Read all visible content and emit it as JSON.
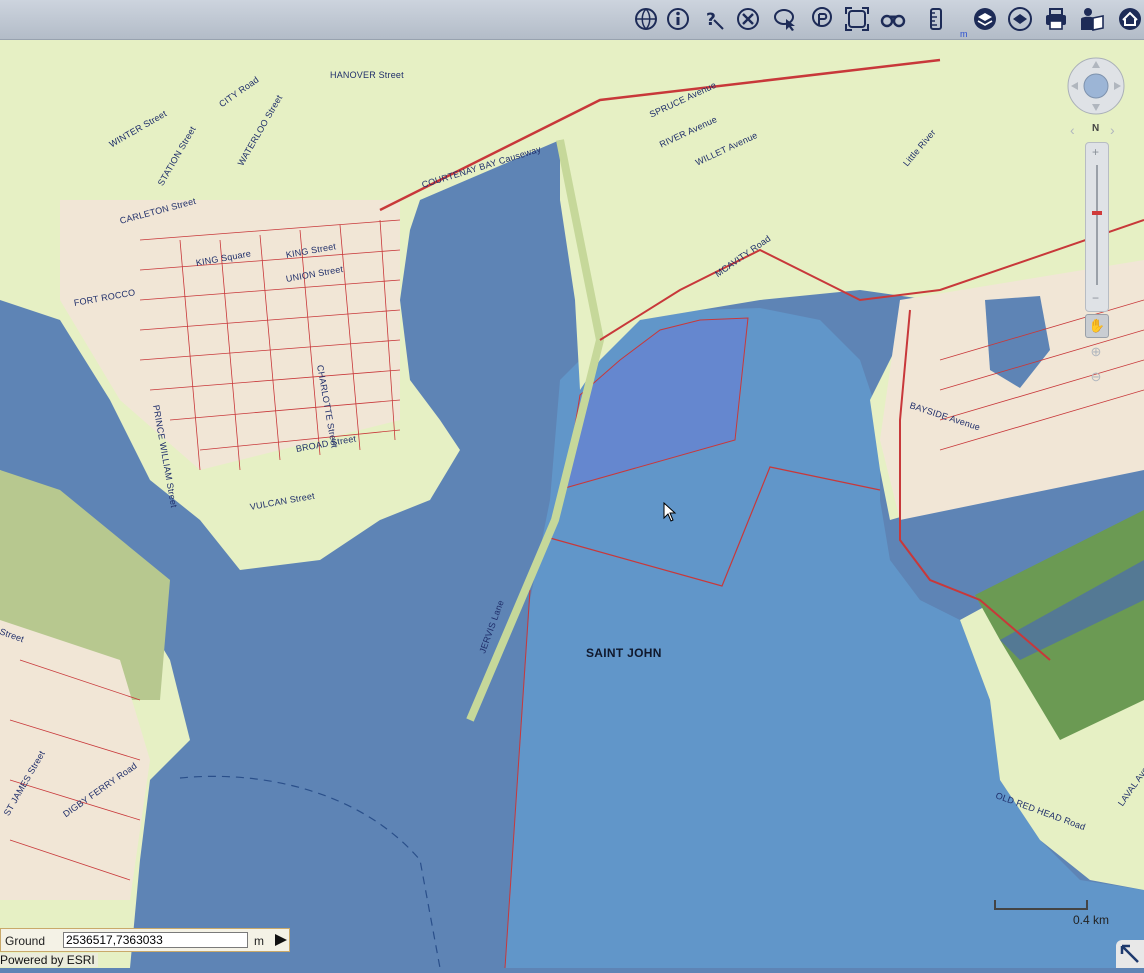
{
  "toolbar": {
    "tools": [
      {
        "name": "globe-icon"
      },
      {
        "name": "info-icon"
      },
      {
        "name": "query-icon"
      },
      {
        "name": "clear-icon"
      },
      {
        "name": "select-icon"
      },
      {
        "name": "identify-icon"
      },
      {
        "name": "extent-icon"
      },
      {
        "name": "binoculars-icon"
      },
      {
        "name": "measure-icon"
      },
      {
        "name": "layers-icon"
      },
      {
        "name": "basemap-icon"
      },
      {
        "name": "print-icon"
      },
      {
        "name": "help-icon"
      },
      {
        "name": "home-icon"
      }
    ],
    "unit_mark": "m"
  },
  "map": {
    "place_label": "SAINT JOHN",
    "street_labels": [
      "HANOVER Street",
      "WINTER Street",
      "CITY Road",
      "STATION Street",
      "WATERLOO Street",
      "COURTENAY BAY Causeway",
      "SPRUCE Avenue",
      "RIVER Avenue",
      "WILLET Avenue",
      "MCAVITY Road",
      "Little River",
      "CARLETON Street",
      "KING Square",
      "KING Street",
      "UNION Street",
      "FORT ROCCO",
      "CHARLOTTE Street",
      "PRINCE WILLIAM Street",
      "BROAD Street",
      "VULCAN Street",
      "JERVIS Lane",
      "DIGBY FERRY Road",
      "ST JAMES Street",
      "OLD RED HEAD Road",
      "BAYSIDE Avenue",
      "Street",
      "LAVAL Avenue"
    ],
    "colors": {
      "harbour_water": "#5e84b5",
      "bay_water": "#6196c9",
      "land": "#e6f0c4",
      "urban": "#f1e6d6",
      "parcel_lines": "#c8383a",
      "park": "#a8bc86"
    }
  },
  "navigation": {
    "north_label": "N",
    "zoom_in": "+",
    "zoom_out": "−",
    "zoom_level": 0.62
  },
  "scalebar": {
    "label": "0.4 km"
  },
  "coordinates": {
    "mode": "Ground",
    "value": "2536517,7363033",
    "unit": "m"
  },
  "footer": {
    "powered_by": "Powered by ESRI"
  }
}
